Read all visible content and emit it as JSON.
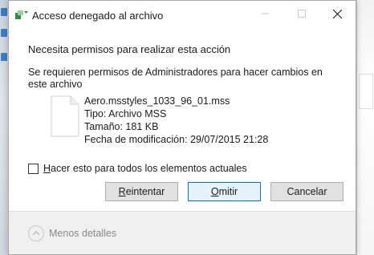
{
  "window": {
    "title": "Acceso denegado al archivo",
    "buttons": {
      "minimize": "minimize",
      "maximize": "maximize",
      "close": "close"
    }
  },
  "dialog": {
    "main_instruction": "Necesita permisos para realizar esta acción",
    "content": "Se requieren permisos de Administradores para hacer cambios en este archivo",
    "file": {
      "name": "Aero.msstyles_1033_96_01.mss",
      "type": "Tipo: Archivo MSS",
      "size": "Tamaño: 181 KB",
      "modified": "Fecha de modificación: 29/07/2015 21:28"
    },
    "checkbox": {
      "mnemonic": "H",
      "label_rest": "acer esto para todos los elementos actuales",
      "checked": false
    },
    "buttons": {
      "retry_mnemonic": "R",
      "retry_rest": "eintentar",
      "skip_mnemonic": "O",
      "skip_rest": "mitir",
      "cancel": "Cancelar"
    },
    "details_label": "Menos detalles"
  },
  "colors": {
    "accent": "#0078d7",
    "dialog_bg": "#ffffff",
    "footer_bg": "#f0f0f0"
  }
}
